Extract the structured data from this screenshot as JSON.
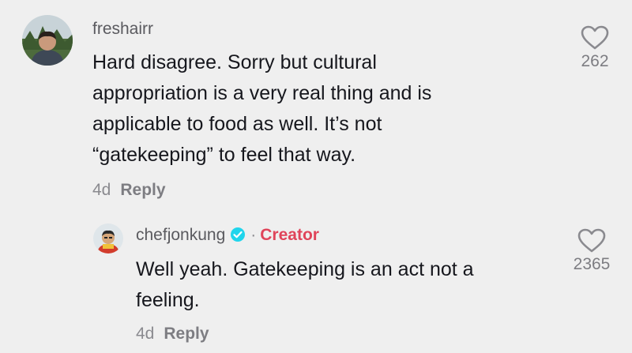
{
  "comments": [
    {
      "username": "freshairr",
      "text_lines": [
        "Hard disagree. Sorry but cultural",
        "appropriation is a very real thing and is",
        "applicable to food as well. It’s not",
        "“gatekeeping” to feel that way."
      ],
      "age": "4d",
      "reply_label": "Reply",
      "like_count": "262",
      "avatar_icon": "user-photo-avatar",
      "like_icon": "heart-outline-icon"
    }
  ],
  "replies": [
    {
      "username": "chefjonkung",
      "verified_icon": "verified-check-icon",
      "separator": "·",
      "creator_label": "Creator",
      "text_lines": [
        "Well yeah. Gatekeeping is an act not a",
        "feeling."
      ],
      "age": "4d",
      "reply_label": "Reply",
      "like_count": "2365",
      "avatar_icon": "chef-cartoon-avatar",
      "like_icon": "heart-outline-icon"
    }
  ],
  "colors": {
    "background": "#efefef",
    "creator_accent": "#e0445a",
    "verified_blue": "#20d5ec",
    "muted_text": "#8a8a8f"
  }
}
